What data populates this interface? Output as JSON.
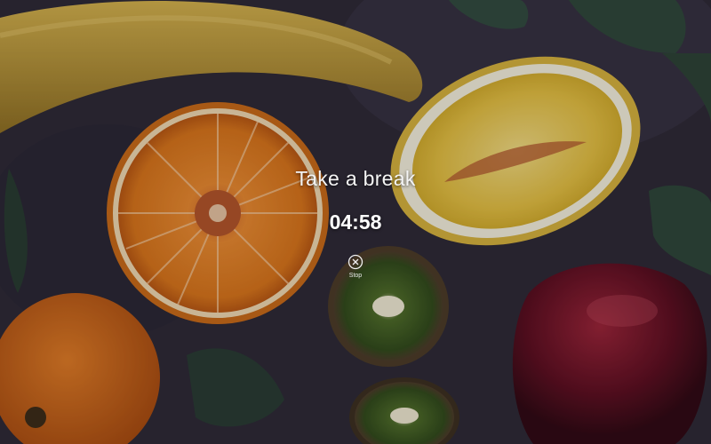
{
  "break_screen": {
    "title": "Take a break",
    "timer": "04:58",
    "stop_label": "Stop",
    "stop_icon": "close-circle-icon"
  },
  "background": {
    "description_icon": "fruit-wallpaper",
    "colors": {
      "surface": "#2a2733",
      "orange": "#e07a1c",
      "lemon": "#e8c445",
      "banana": "#c9a63a",
      "kiwi": "#4f6b2a",
      "apple": "#5a0d1c",
      "leaf": "#2d4a3a"
    }
  }
}
